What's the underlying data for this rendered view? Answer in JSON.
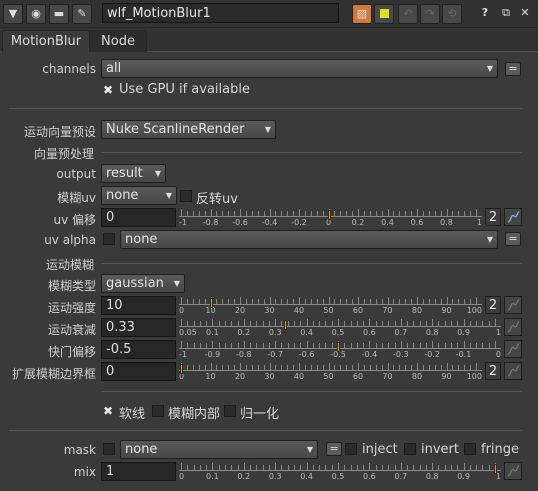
{
  "window": {
    "node_name": "wlf_MotionBlur1",
    "help_label": "?",
    "tabs": [
      "MotionBlur",
      "Node"
    ]
  },
  "colors": {
    "background": "#3a3a3a",
    "field": "#262626",
    "handle": "#d69b3a",
    "accent_yellow": "#e0e020",
    "accent_orange": "#e07a30"
  },
  "icons": [
    "triangle-down-icon",
    "circle-icon",
    "node-icon",
    "wrench-icon",
    "color-swatch-icon",
    "yellow-swatch-icon",
    "undo-icon",
    "redo-icon",
    "revert-icon",
    "help-icon",
    "float-icon",
    "close-icon",
    "curve-icon",
    "equals-icon",
    "check-icon"
  ],
  "channels": {
    "label": "channels",
    "value": "all",
    "eq": "="
  },
  "use_gpu": {
    "label": "Use GPU if available",
    "checked": true
  },
  "preset": {
    "label": "运动向量预设",
    "value": "Nuke ScanlineRender"
  },
  "vector_group": {
    "label": "向量预处理"
  },
  "output": {
    "label": "output",
    "value": "result"
  },
  "blur_uv": {
    "label": "模糊uv",
    "value": "none",
    "invert_label": "反转uv"
  },
  "uv_offset": {
    "label": "uv 偏移",
    "value": "0",
    "button": "2",
    "slider": {
      "min": -1,
      "max": 1,
      "value": 0,
      "ticks": [
        "-1",
        "-0.8",
        "-0.6",
        "-0.4",
        "-0.2",
        "0",
        "0.2",
        "0.4",
        "0.6",
        "0.8",
        "1"
      ]
    }
  },
  "uv_alpha": {
    "label": "uv alpha",
    "value": "none",
    "eq": "="
  },
  "motion_group": {
    "label": "运动模糊"
  },
  "blur_type": {
    "label": "模糊类型",
    "value": "gaussian"
  },
  "strength": {
    "label": "运动强度",
    "value": "10",
    "button": "2",
    "slider": {
      "min": 0,
      "max": 100,
      "value": 10,
      "ticks": [
        "0",
        "10",
        "20",
        "30",
        "40",
        "50",
        "60",
        "70",
        "80",
        "90",
        "100"
      ]
    }
  },
  "decay": {
    "label": "运动衰减",
    "value": "0.33",
    "slider": {
      "min": 0,
      "max": 1,
      "value": 0.33,
      "ticks": [
        "0.05",
        "0.1",
        "0.2",
        "0.3",
        "0.4",
        "0.5",
        "0.6",
        "0.7",
        "0.8",
        "0.9",
        "1"
      ]
    }
  },
  "shutter": {
    "label": "快门偏移",
    "value": "-0.5",
    "slider": {
      "min": -1,
      "max": 0,
      "value": -0.5,
      "ticks": [
        "-1",
        "-0.9",
        "-0.8",
        "-0.7",
        "-0.6",
        "-0.5",
        "-0.4",
        "-0.3",
        "-0.2",
        "-0.1",
        "0"
      ]
    }
  },
  "expand": {
    "label": "扩展模糊边界框",
    "value": "0",
    "button": "2",
    "slider": {
      "min": 0,
      "max": 100,
      "value": 0,
      "ticks": [
        "0",
        "10",
        "20",
        "30",
        "40",
        "50",
        "60",
        "70",
        "80",
        "90",
        "100"
      ]
    }
  },
  "options": {
    "soft_label": "软线",
    "soft_checked": true,
    "inside_label": "模糊内部",
    "normalize_label": "归一化"
  },
  "mask": {
    "label": "mask",
    "value": "none",
    "eq": "=",
    "inject": "inject",
    "invert": "invert",
    "fringe": "fringe"
  },
  "mix": {
    "label": "mix",
    "value": "1",
    "slider": {
      "min": 0,
      "max": 1,
      "value": 1,
      "ticks": [
        "0",
        "0.1",
        "0.2",
        "0.3",
        "0.4",
        "0.5",
        "0.6",
        "0.7",
        "0.8",
        "0.9",
        "1"
      ]
    }
  }
}
